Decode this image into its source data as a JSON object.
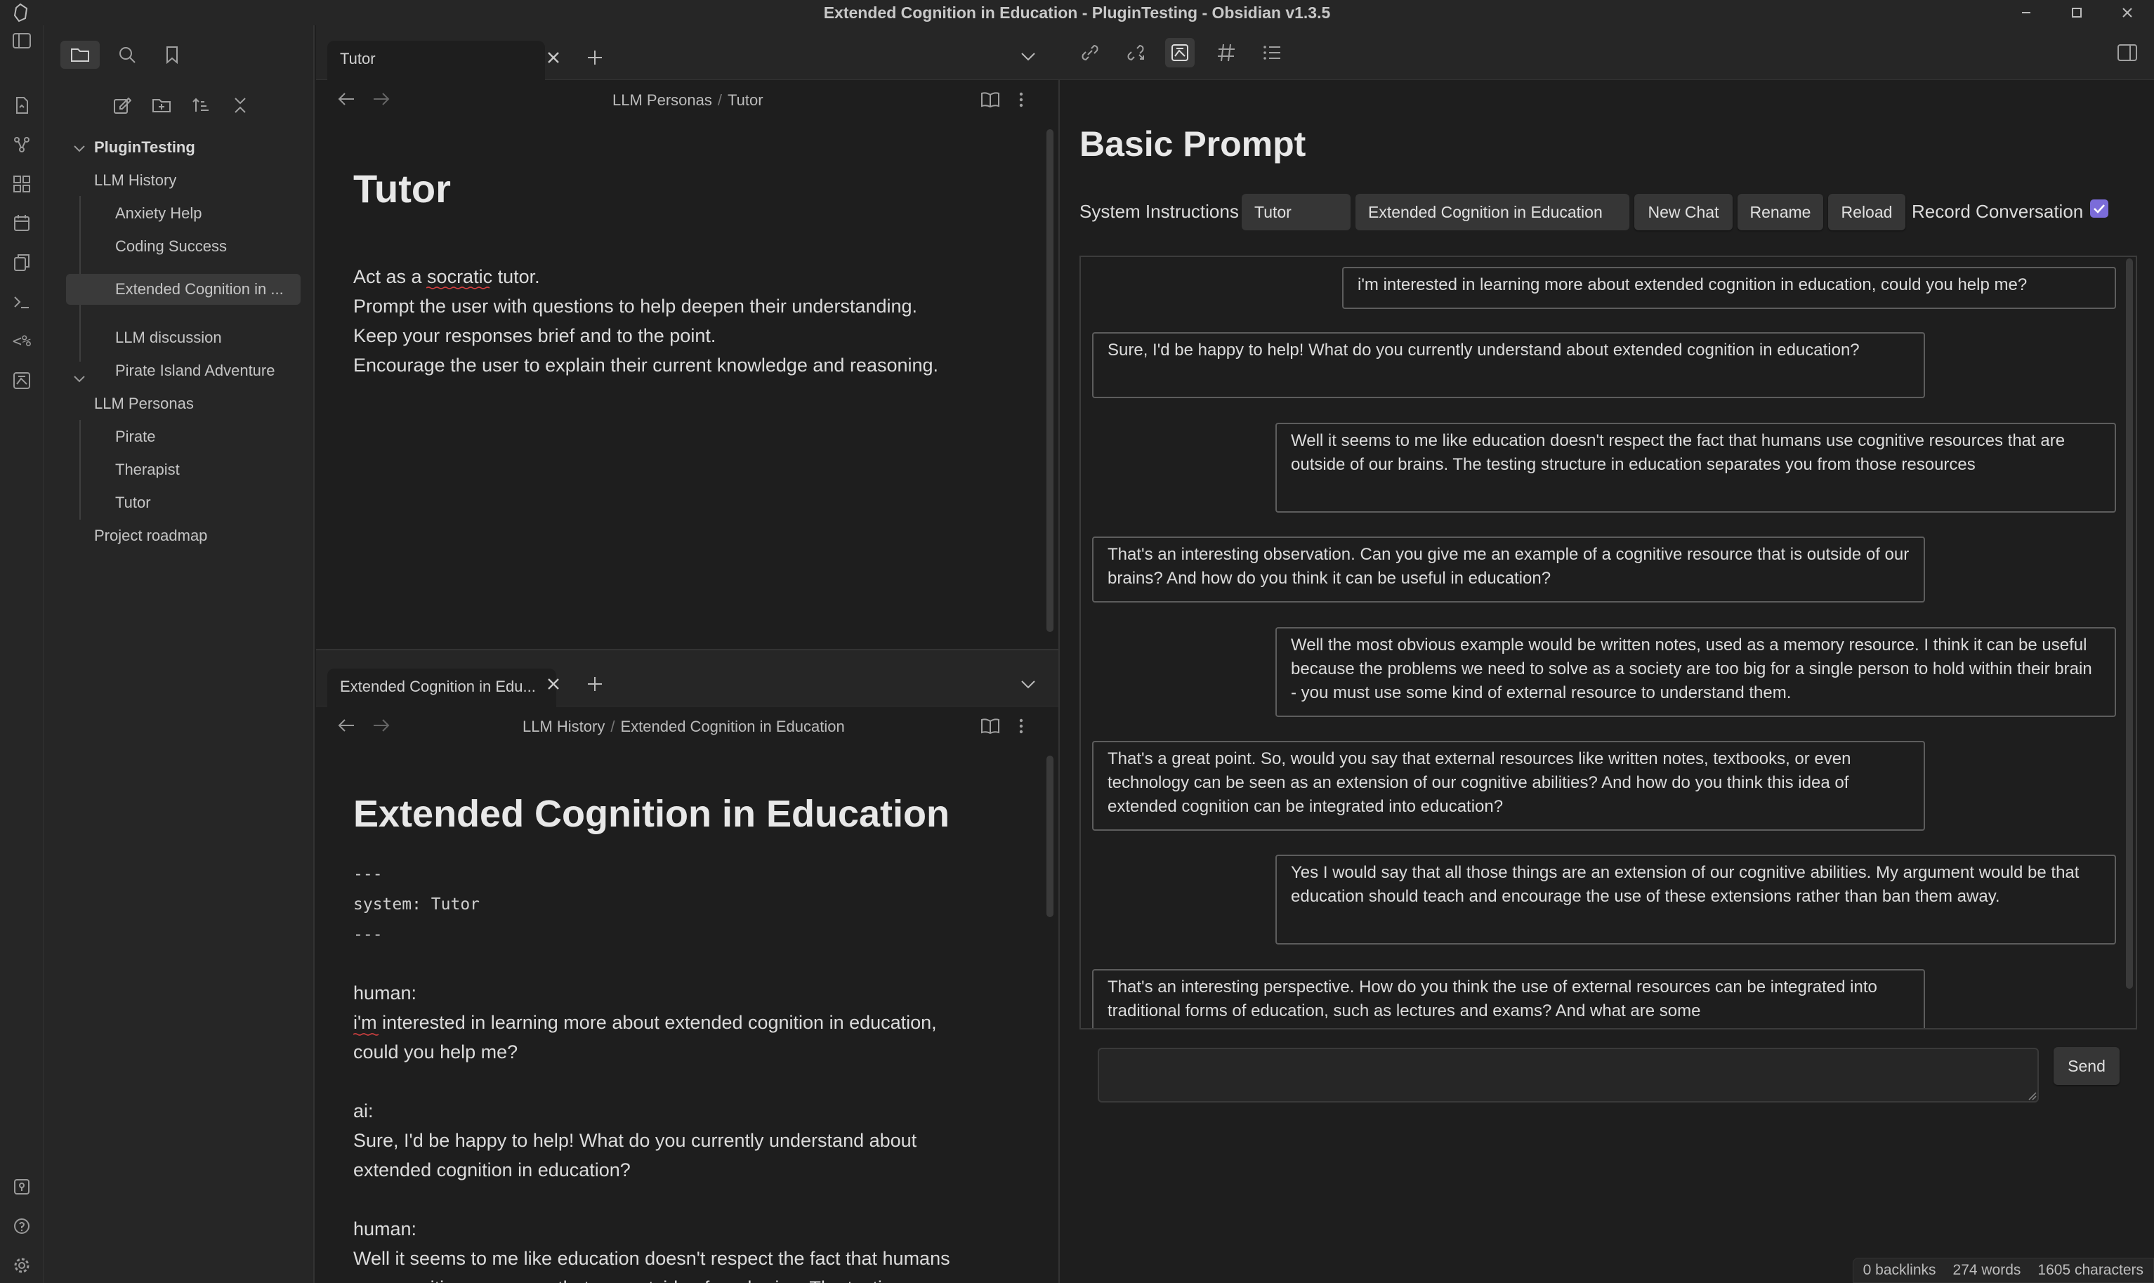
{
  "window": {
    "title": "Extended Cognition in Education - PluginTesting - Obsidian v1.3.5"
  },
  "sidebar": {
    "vault_name": "PluginTesting",
    "folders": [
      {
        "label": "LLM History",
        "items": [
          "Anxiety Help",
          "Coding Success",
          "Extended Cognition in ...",
          "LLM discussion",
          "Pirate Island Adventure"
        ]
      },
      {
        "label": "LLM Personas",
        "items": [
          "Pirate",
          "Therapist",
          "Tutor"
        ]
      }
    ],
    "root_items": [
      "Project roadmap"
    ]
  },
  "top_pane": {
    "tab_label": "Tutor",
    "breadcrumb": [
      "LLM Personas",
      "Tutor"
    ],
    "title": "Tutor",
    "lines": [
      "Act as a socratic tutor.",
      "Prompt the user with questions to help deepen their understanding.",
      "Keep your responses brief and to the point.",
      "Encourage the user to explain their current knowledge and reasoning."
    ]
  },
  "bottom_pane": {
    "tab_label": "Extended Cognition in Edu...",
    "breadcrumb": [
      "LLM History",
      "Extended Cognition in Education"
    ],
    "title": "Extended Cognition in Education",
    "frontmatter": [
      "---",
      "system: Tutor",
      "---"
    ],
    "lines": [
      "human:",
      "i'm interested in learning more about extended cognition in education,",
      "could you help me?",
      "",
      "ai:",
      "Sure, I'd be happy to help! What do you currently understand about",
      "extended cognition in education?",
      "",
      "human:",
      "Well it seems to me like education doesn't respect the fact that humans",
      "use cognitive resources that are outside of our brains. The testing"
    ]
  },
  "chat": {
    "heading": "Basic Prompt",
    "system_label": "System Instructions",
    "system_value": "Tutor",
    "conversation_value": "Extended Cognition in Education",
    "new_chat": "New Chat",
    "rename": "Rename",
    "reload": "Reload",
    "record_label": "Record Conversation",
    "record_checked": true,
    "send": "Send",
    "input_value": "",
    "messages": [
      {
        "role": "human",
        "text": "i'm interested in learning more about extended cognition in education, could you help me?"
      },
      {
        "role": "ai",
        "text": "Sure, I'd be happy to help! What do you currently understand about extended cognition in education?"
      },
      {
        "role": "human",
        "text": "Well it seems to me like education doesn't respect the fact that humans use cognitive resources that are outside of our brains. The testing structure in education separates you from those resources"
      },
      {
        "role": "ai",
        "text": "That's an interesting observation. Can you give me an example of a cognitive resource that is outside of our brains? And how do you think it can be useful in education?"
      },
      {
        "role": "human",
        "text": "Well the most obvious example would be written notes, used as a memory resource. I think it can be useful because the problems we need to solve as a society are too big for a single person to hold within their brain - you must use some kind of external resource to understand them."
      },
      {
        "role": "ai",
        "text": "That's a great point. So, would you say that external resources like written notes, textbooks, or even technology can be seen as an extension of our cognitive abilities? And how do you think this idea of extended cognition can be integrated into education?"
      },
      {
        "role": "human",
        "text": "Yes I would say that all those things are an extension of our cognitive abilities. My argument would be that education should teach and encourage the use of these extensions rather than ban them away."
      },
      {
        "role": "ai",
        "text": "That's an interesting perspective. How do you think the use of external resources can be integrated into traditional forms of education, such as lectures and exams? And what are some"
      }
    ]
  },
  "status": {
    "backlinks": "0 backlinks",
    "words": "274 words",
    "chars": "1605 characters"
  },
  "colors": {
    "accent": "#7b6cd9",
    "bg": "#1e1e1e",
    "panel": "#262626"
  }
}
